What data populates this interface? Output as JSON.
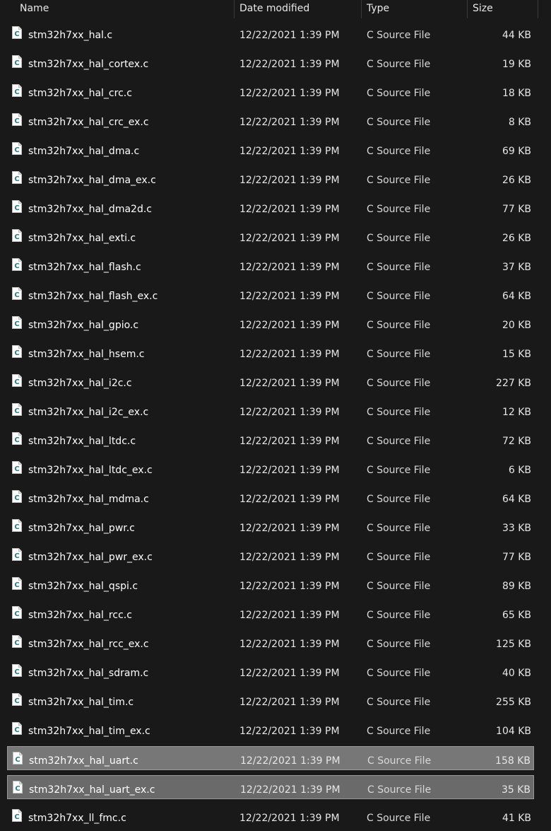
{
  "columns": {
    "name": "Name",
    "date": "Date modified",
    "type": "Type",
    "size": "Size"
  },
  "icon": "c-source-file-icon",
  "files": [
    {
      "name": "stm32h7xx_hal.c",
      "date": "12/22/2021 1:39 PM",
      "type": "C Source File",
      "size": "44 KB"
    },
    {
      "name": "stm32h7xx_hal_cortex.c",
      "date": "12/22/2021 1:39 PM",
      "type": "C Source File",
      "size": "19 KB"
    },
    {
      "name": "stm32h7xx_hal_crc.c",
      "date": "12/22/2021 1:39 PM",
      "type": "C Source File",
      "size": "18 KB"
    },
    {
      "name": "stm32h7xx_hal_crc_ex.c",
      "date": "12/22/2021 1:39 PM",
      "type": "C Source File",
      "size": "8 KB"
    },
    {
      "name": "stm32h7xx_hal_dma.c",
      "date": "12/22/2021 1:39 PM",
      "type": "C Source File",
      "size": "69 KB"
    },
    {
      "name": "stm32h7xx_hal_dma_ex.c",
      "date": "12/22/2021 1:39 PM",
      "type": "C Source File",
      "size": "26 KB"
    },
    {
      "name": "stm32h7xx_hal_dma2d.c",
      "date": "12/22/2021 1:39 PM",
      "type": "C Source File",
      "size": "77 KB"
    },
    {
      "name": "stm32h7xx_hal_exti.c",
      "date": "12/22/2021 1:39 PM",
      "type": "C Source File",
      "size": "26 KB"
    },
    {
      "name": "stm32h7xx_hal_flash.c",
      "date": "12/22/2021 1:39 PM",
      "type": "C Source File",
      "size": "37 KB"
    },
    {
      "name": "stm32h7xx_hal_flash_ex.c",
      "date": "12/22/2021 1:39 PM",
      "type": "C Source File",
      "size": "64 KB"
    },
    {
      "name": "stm32h7xx_hal_gpio.c",
      "date": "12/22/2021 1:39 PM",
      "type": "C Source File",
      "size": "20 KB"
    },
    {
      "name": "stm32h7xx_hal_hsem.c",
      "date": "12/22/2021 1:39 PM",
      "type": "C Source File",
      "size": "15 KB"
    },
    {
      "name": "stm32h7xx_hal_i2c.c",
      "date": "12/22/2021 1:39 PM",
      "type": "C Source File",
      "size": "227 KB"
    },
    {
      "name": "stm32h7xx_hal_i2c_ex.c",
      "date": "12/22/2021 1:39 PM",
      "type": "C Source File",
      "size": "12 KB"
    },
    {
      "name": "stm32h7xx_hal_ltdc.c",
      "date": "12/22/2021 1:39 PM",
      "type": "C Source File",
      "size": "72 KB"
    },
    {
      "name": "stm32h7xx_hal_ltdc_ex.c",
      "date": "12/22/2021 1:39 PM",
      "type": "C Source File",
      "size": "6 KB"
    },
    {
      "name": "stm32h7xx_hal_mdma.c",
      "date": "12/22/2021 1:39 PM",
      "type": "C Source File",
      "size": "64 KB"
    },
    {
      "name": "stm32h7xx_hal_pwr.c",
      "date": "12/22/2021 1:39 PM",
      "type": "C Source File",
      "size": "33 KB"
    },
    {
      "name": "stm32h7xx_hal_pwr_ex.c",
      "date": "12/22/2021 1:39 PM",
      "type": "C Source File",
      "size": "77 KB"
    },
    {
      "name": "stm32h7xx_hal_qspi.c",
      "date": "12/22/2021 1:39 PM",
      "type": "C Source File",
      "size": "89 KB"
    },
    {
      "name": "stm32h7xx_hal_rcc.c",
      "date": "12/22/2021 1:39 PM",
      "type": "C Source File",
      "size": "65 KB"
    },
    {
      "name": "stm32h7xx_hal_rcc_ex.c",
      "date": "12/22/2021 1:39 PM",
      "type": "C Source File",
      "size": "125 KB"
    },
    {
      "name": "stm32h7xx_hal_sdram.c",
      "date": "12/22/2021 1:39 PM",
      "type": "C Source File",
      "size": "40 KB"
    },
    {
      "name": "stm32h7xx_hal_tim.c",
      "date": "12/22/2021 1:39 PM",
      "type": "C Source File",
      "size": "255 KB"
    },
    {
      "name": "stm32h7xx_hal_tim_ex.c",
      "date": "12/22/2021 1:39 PM",
      "type": "C Source File",
      "size": "104 KB"
    },
    {
      "name": "stm32h7xx_hal_uart.c",
      "date": "12/22/2021 1:39 PM",
      "type": "C Source File",
      "size": "158 KB",
      "selected": true
    },
    {
      "name": "stm32h7xx_hal_uart_ex.c",
      "date": "12/22/2021 1:39 PM",
      "type": "C Source File",
      "size": "35 KB",
      "selected": true
    },
    {
      "name": "stm32h7xx_ll_fmc.c",
      "date": "12/22/2021 1:39 PM",
      "type": "C Source File",
      "size": "41 KB"
    }
  ]
}
